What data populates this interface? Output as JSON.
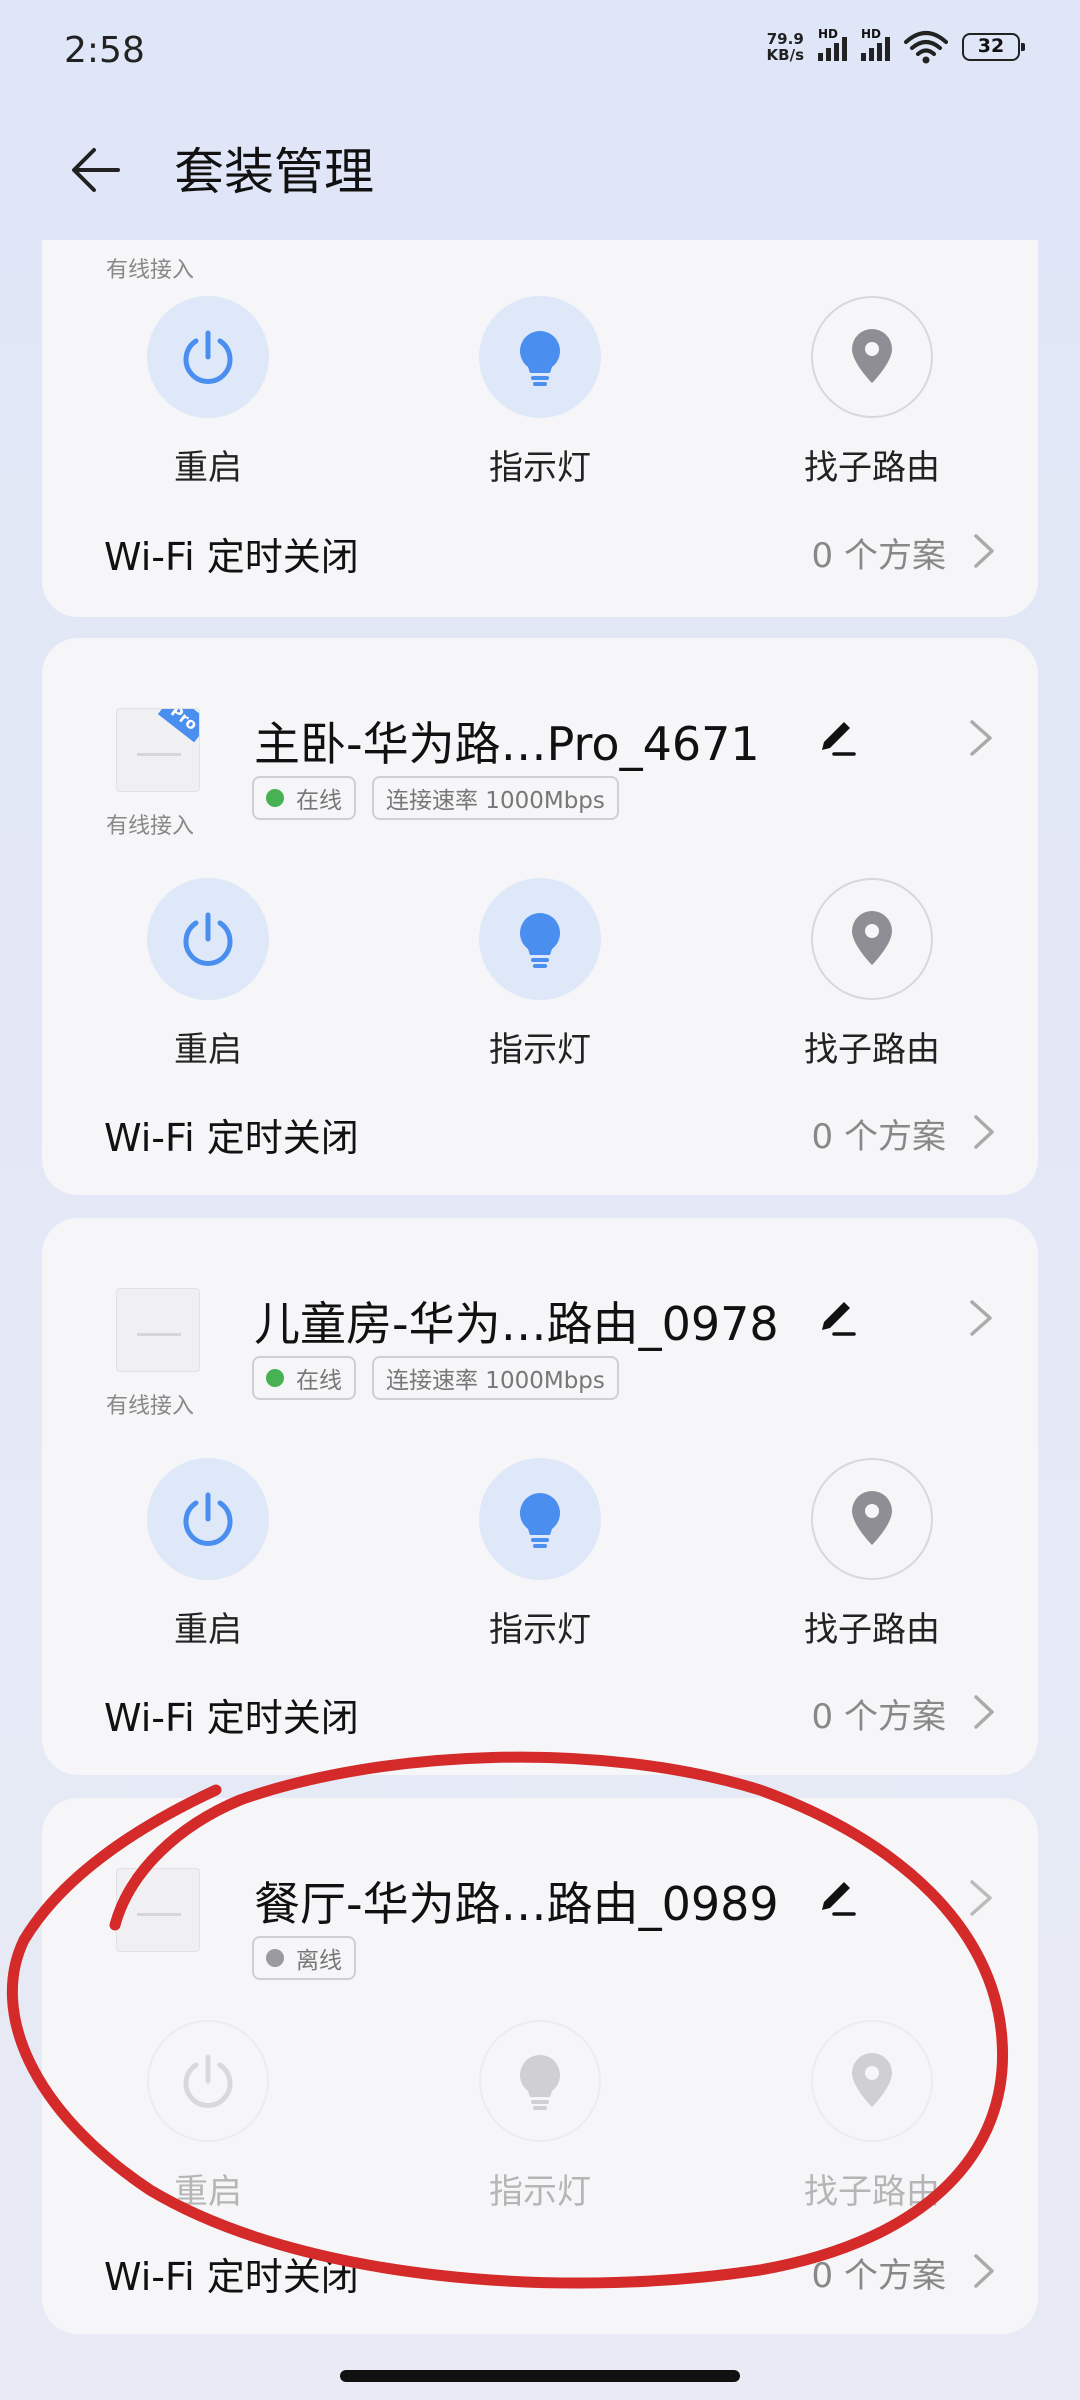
{
  "status": {
    "time": "2:58",
    "speed_value": "79.9",
    "speed_unit": "KB/s",
    "sim1_label": "HD",
    "sim2_label": "HD",
    "battery": "32"
  },
  "header": {
    "title": "套装管理",
    "back_icon": "arrow-left-icon"
  },
  "devices": [
    {
      "name": "",
      "wired_label": "有线接入",
      "actions": [
        "重启",
        "指示灯",
        "找子路由"
      ],
      "wifi_label": "Wi-Fi 定时关闭",
      "wifi_count": "0 个方案"
    },
    {
      "name": "主卧-华为路…Pro_4671",
      "badge": "Pro",
      "wired_label": "有线接入",
      "status": "在线",
      "rate": "连接速率 1000Mbps",
      "status_color": "#46b253",
      "actions": [
        "重启",
        "指示灯",
        "找子路由"
      ],
      "wifi_label": "Wi-Fi 定时关闭",
      "wifi_count": "0 个方案"
    },
    {
      "name": "儿童房-华为…路由_0978",
      "wired_label": "有线接入",
      "status": "在线",
      "rate": "连接速率 1000Mbps",
      "status_color": "#46b253",
      "actions": [
        "重启",
        "指示灯",
        "找子路由"
      ],
      "wifi_label": "Wi-Fi 定时关闭",
      "wifi_count": "0 个方案"
    },
    {
      "name": "餐厅-华为路…路由_0989",
      "status": "离线",
      "status_color": "#9a9aa0",
      "actions": [
        "重启",
        "指示灯",
        "找子路由"
      ],
      "wifi_label": "Wi-Fi 定时关闭",
      "wifi_count": "0 个方案"
    }
  ],
  "colors": {
    "accent_blue": "#4a8ef0",
    "annotation_red": "#d42a2a"
  }
}
